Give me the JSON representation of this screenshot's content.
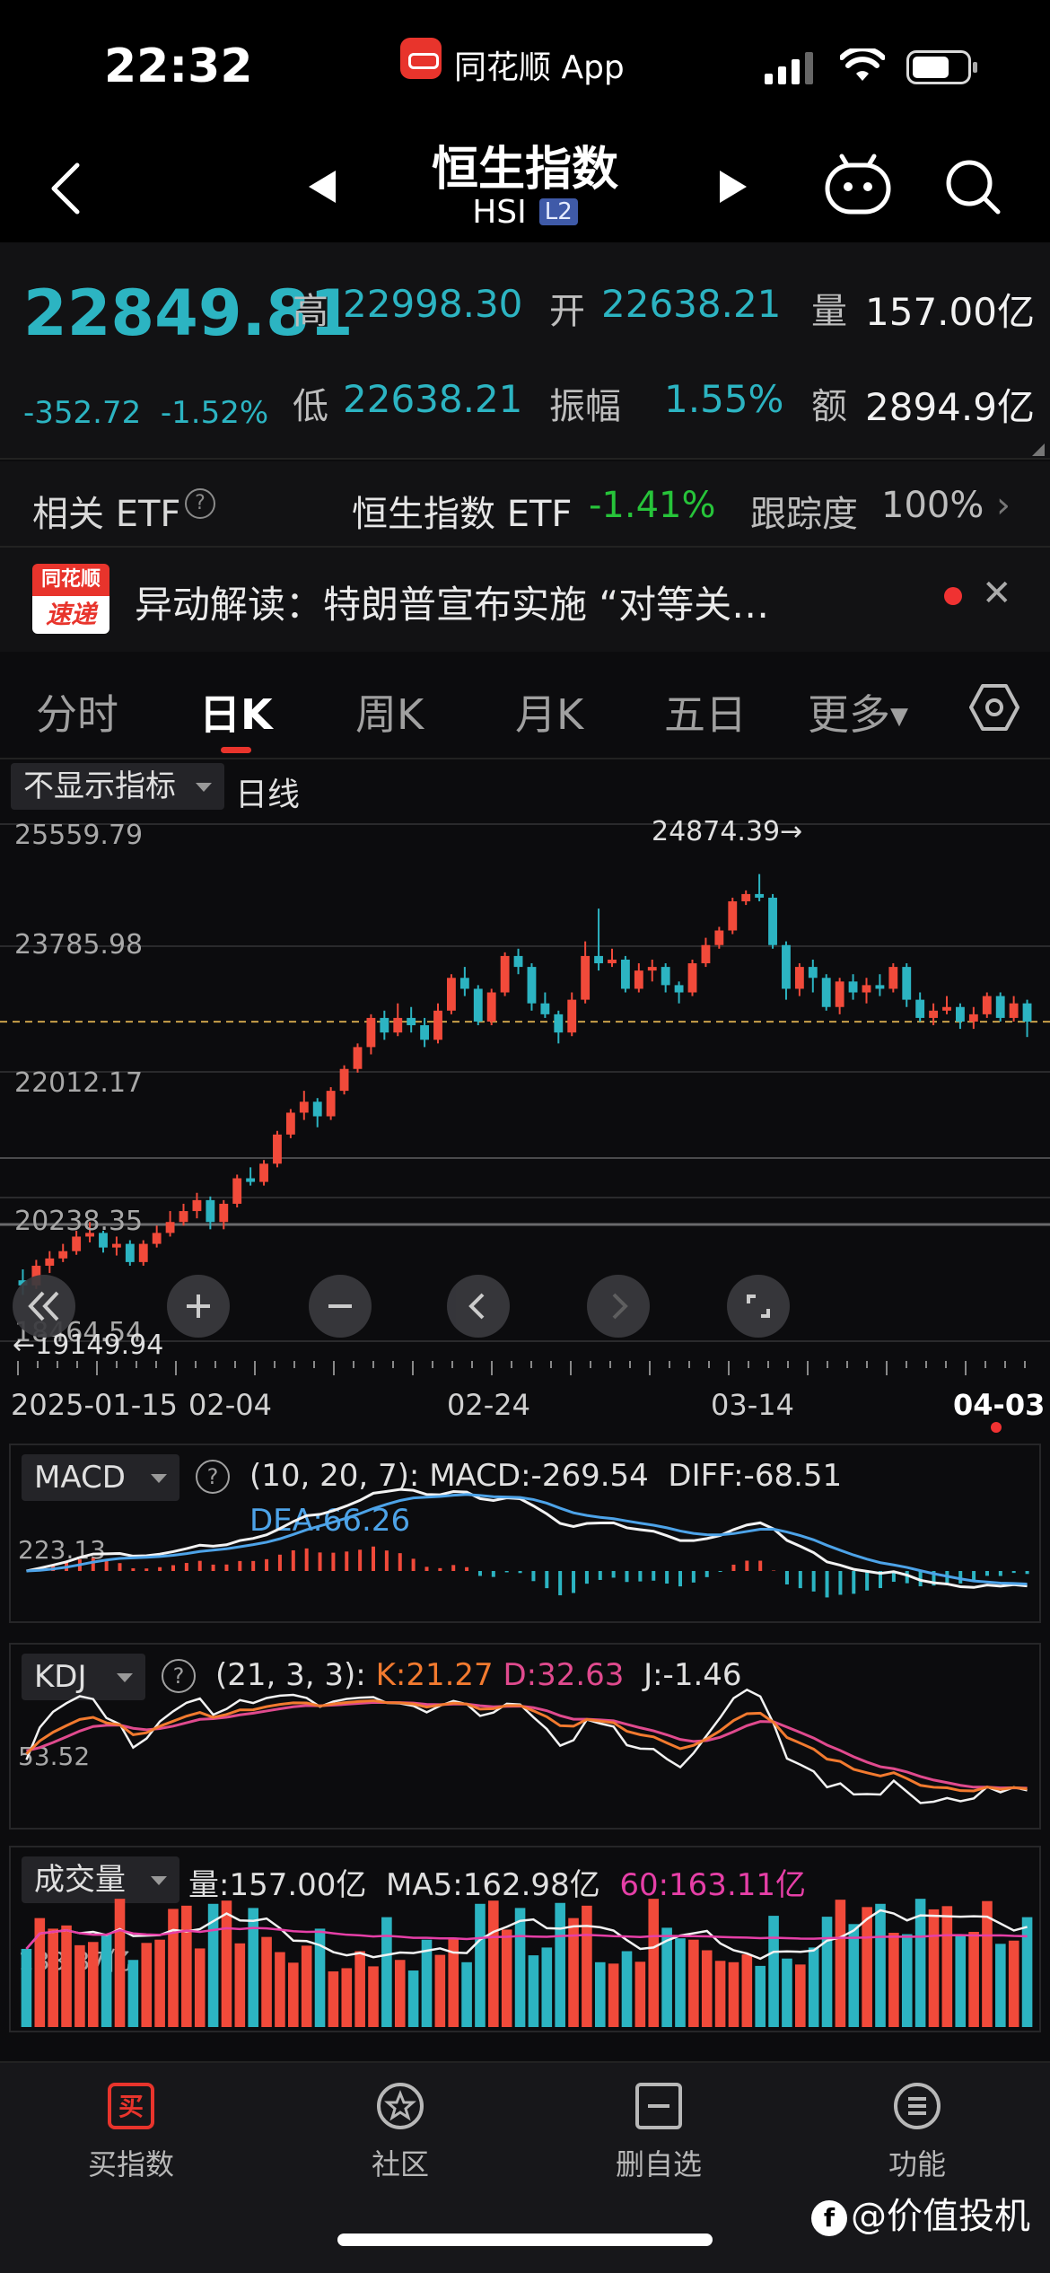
{
  "status": {
    "time": "22:32",
    "app_name": "同花顺 App"
  },
  "header": {
    "title": "恒生指数",
    "ticker": "HSI",
    "level_badge": "L2"
  },
  "quote": {
    "last": "22849.81",
    "change": "-352.72",
    "change_pct": "-1.52%",
    "high_label": "高",
    "high": "22998.30",
    "low_label": "低",
    "low": "22638.21",
    "open_label": "开",
    "open": "22638.21",
    "amp_label": "振幅",
    "amp": "1.55%",
    "vol_label": "量",
    "vol": "157.00亿",
    "amt_label": "额",
    "amt": "2894.9亿"
  },
  "etf": {
    "label": "相关 ETF",
    "help": "?",
    "name": "恒生指数 ETF",
    "change": "-1.41%",
    "track_label": "跟踪度",
    "track": "100%"
  },
  "news": {
    "logo_top": "同花顺",
    "logo_bottom": "速递",
    "text": "异动解读：特朗普宣布实施 “对等关…",
    "close": "✕"
  },
  "tabs": [
    {
      "label": "分时"
    },
    {
      "label": "日K"
    },
    {
      "label": "周K"
    },
    {
      "label": "月K"
    },
    {
      "label": "五日"
    },
    {
      "label": "更多"
    }
  ],
  "chart": {
    "indicator_select": "不显示指标",
    "line_type": "日线",
    "y_labels": [
      "25559.79",
      "23785.98",
      "22012.17",
      "20238.35",
      "18464.54"
    ],
    "max_label": "24874.39→",
    "min_label": "←19149.94",
    "dates": [
      "2025-01-15",
      "02-04",
      "02-24",
      "03-14",
      "04-03"
    ]
  },
  "macd": {
    "select": "MACD",
    "params": "(10, 20, 7):",
    "macd_text": "MACD:-269.54",
    "diff_text": "DIFF:-68.51",
    "dea_text": "DEA:66.26",
    "axis_label": "223.13"
  },
  "kdj": {
    "select": "KDJ",
    "params": "(21, 3, 3):",
    "k_text": "K:21.27",
    "d_text": "D:32.63",
    "j_text": "J:-1.46",
    "axis_label": "53.52"
  },
  "volume": {
    "select": "成交量",
    "vol_text": "量:157.00亿",
    "ma5_text": "MA5:162.98亿",
    "ma60_text": "60:163.11亿",
    "axis_label": "133.87亿"
  },
  "nav": [
    {
      "label": "买指数",
      "icon": "buy-icon"
    },
    {
      "label": "社区",
      "icon": "community-icon"
    },
    {
      "label": "删自选",
      "icon": "remove-watchlist-icon"
    },
    {
      "label": "功能",
      "icon": "menu-icon"
    }
  ],
  "watermark": "@价值投机",
  "colors": {
    "up": "#f14a3a",
    "down": "#2cb4c2",
    "accent": "#e8342c"
  },
  "chart_data": {
    "type": "candlestick",
    "x_start": "2025-01-15",
    "x_end": "2025-04-03",
    "ylim": [
      18464.54,
      25559.79
    ],
    "candles": [
      [
        19300,
        19230,
        19450,
        19100
      ],
      [
        19230,
        19500,
        19580,
        19180
      ],
      [
        19500,
        19600,
        19700,
        19400
      ],
      [
        19600,
        19700,
        19800,
        19550
      ],
      [
        19700,
        19900,
        19980,
        19650
      ],
      [
        19900,
        19950,
        20100,
        19820
      ],
      [
        19950,
        19750,
        19980,
        19680
      ],
      [
        19750,
        19800,
        19900,
        19640
      ],
      [
        19800,
        19550,
        19850,
        19500
      ],
      [
        19550,
        19800,
        19850,
        19500
      ],
      [
        19800,
        19950,
        20050,
        19750
      ],
      [
        19950,
        20100,
        20250,
        19900
      ],
      [
        20100,
        20250,
        20350,
        20050
      ],
      [
        20250,
        20400,
        20500,
        20150
      ],
      [
        20400,
        20100,
        20450,
        20000
      ],
      [
        20100,
        20350,
        20400,
        20000
      ],
      [
        20350,
        20700,
        20750,
        20300
      ],
      [
        20700,
        20650,
        20850,
        20600
      ],
      [
        20650,
        20900,
        20950,
        20600
      ],
      [
        20900,
        21300,
        21350,
        20850
      ],
      [
        21300,
        21600,
        21650,
        21250
      ],
      [
        21600,
        21750,
        21900,
        21500
      ],
      [
        21750,
        21550,
        21800,
        21400
      ],
      [
        21550,
        21900,
        21950,
        21500
      ],
      [
        21900,
        22200,
        22250,
        21850
      ],
      [
        22200,
        22500,
        22550,
        22150
      ],
      [
        22500,
        22900,
        22950,
        22400
      ],
      [
        22900,
        22700,
        23000,
        22600
      ],
      [
        22700,
        22900,
        23100,
        22650
      ],
      [
        22900,
        22800,
        23050,
        22700
      ],
      [
        22800,
        22600,
        22900,
        22500
      ],
      [
        22600,
        23000,
        23100,
        22550
      ],
      [
        23000,
        23450,
        23500,
        22950
      ],
      [
        23450,
        23300,
        23600,
        23200
      ],
      [
        23300,
        22850,
        23350,
        22800
      ],
      [
        22850,
        23250,
        23300,
        22800
      ],
      [
        23250,
        23750,
        23800,
        23200
      ],
      [
        23750,
        23600,
        23850,
        23500
      ],
      [
        23600,
        23100,
        23650,
        23000
      ],
      [
        23100,
        22950,
        23250,
        22900
      ],
      [
        22950,
        22700,
        23000,
        22550
      ],
      [
        22700,
        23150,
        23250,
        22650
      ],
      [
        23150,
        23750,
        23950,
        23100
      ],
      [
        23750,
        23650,
        24400,
        23550
      ],
      [
        23650,
        23700,
        23850,
        23600
      ],
      [
        23700,
        23300,
        23750,
        23250
      ],
      [
        23300,
        23550,
        23650,
        23250
      ],
      [
        23550,
        23600,
        23700,
        23400
      ],
      [
        23600,
        23350,
        23650,
        23250
      ],
      [
        23350,
        23250,
        23400,
        23100
      ],
      [
        23250,
        23650,
        23700,
        23200
      ],
      [
        23650,
        23900,
        24000,
        23600
      ],
      [
        23900,
        24100,
        24150,
        23850
      ],
      [
        24100,
        24500,
        24550,
        24050
      ],
      [
        24500,
        24600,
        24650,
        24450
      ],
      [
        24600,
        24550,
        24874,
        24500
      ],
      [
        24550,
        23900,
        24600,
        23850
      ],
      [
        23900,
        23300,
        23950,
        23150
      ],
      [
        23300,
        23600,
        23650,
        23200
      ],
      [
        23600,
        23450,
        23700,
        23250
      ],
      [
        23450,
        23050,
        23500,
        23000
      ],
      [
        23050,
        23400,
        23450,
        22950
      ],
      [
        23400,
        23250,
        23500,
        23150
      ],
      [
        23250,
        23350,
        23450,
        23100
      ],
      [
        23350,
        23300,
        23500,
        23200
      ],
      [
        23300,
        23600,
        23650,
        23250
      ],
      [
        23600,
        23150,
        23650,
        23050
      ],
      [
        23150,
        22900,
        23250,
        22850
      ],
      [
        22900,
        23000,
        23100,
        22800
      ],
      [
        23000,
        23050,
        23200,
        22950
      ],
      [
        23050,
        22850,
        23100,
        22750
      ],
      [
        22850,
        22950,
        23050,
        22750
      ],
      [
        22950,
        23200,
        23250,
        22900
      ],
      [
        23200,
        22900,
        23250,
        22850
      ],
      [
        22900,
        23100,
        23200,
        22850
      ],
      [
        23100,
        22849,
        23150,
        22638
      ]
    ]
  }
}
